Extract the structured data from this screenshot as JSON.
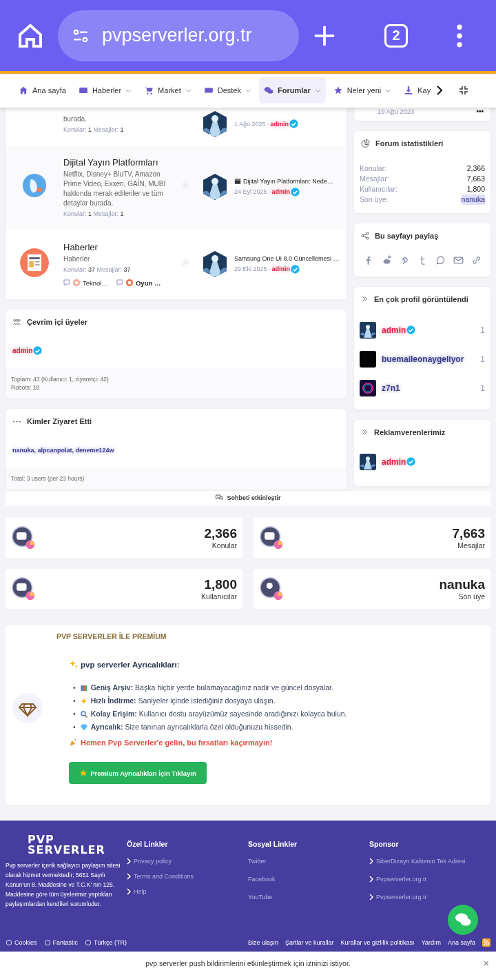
{
  "browser": {
    "url": "pvpserverler.org.tr",
    "tab_count": "2"
  },
  "nav": [
    {
      "label": "Ana sayfa",
      "selected": false,
      "caret": false
    },
    {
      "label": "Haberler",
      "selected": false,
      "caret": true
    },
    {
      "label": "Market",
      "selected": false,
      "caret": true
    },
    {
      "label": "Destek",
      "selected": false,
      "caret": true
    },
    {
      "label": "Forumlar",
      "selected": true,
      "caret": true
    },
    {
      "label": "Neler yeni",
      "selected": false,
      "caret": true
    },
    {
      "label": "Kay",
      "selected": false,
      "caret": false
    }
  ],
  "forums": [
    {
      "partial": true,
      "description": "burada.",
      "topics_label": "Konular:",
      "topics": "1",
      "messages_label": "Mesajlar:",
      "messages": "1",
      "last_date": "1 Ağu 2025",
      "separator": "·",
      "last_user": "admin"
    },
    {
      "partial": false,
      "title": "Dijital Yayın Platformları",
      "description": "Netflix, Disney+ BluTV, Amazon Prime Video, Exxen, GAİN, MUBI hakkında merak edilenler ve tüm detaylar burada.",
      "topics_label": "Konular:",
      "topics": "1",
      "messages_label": "Mesajlar:",
      "messages": "1",
      "last_title": "Dijital Yayın Platformları: Nede…",
      "last_date": "24 Eyl 2025",
      "separator": "·",
      "last_user": "admin"
    },
    {
      "partial": false,
      "title": "Haberler",
      "description": "Haberler",
      "topics_label": "Konular:",
      "topics": "37",
      "messages_label": "Mesajlar:",
      "messages": "37",
      "subforums": [
        "Teknol…",
        "Oyun …"
      ],
      "last_title": "Samsung One UI 8.0 Güncellemesi …",
      "last_date": "29 Eki 2025",
      "separator": "·",
      "last_user": "admin"
    }
  ],
  "online": {
    "title": "Çevrim içi üyeler",
    "users": [
      {
        "name": "admin",
        "color": "#e0244a",
        "verified": true
      }
    ],
    "summary": [
      "Toplam: 43 (Kullanıcı: 1, ziyaretçi: 42)",
      "Robots: 18"
    ]
  },
  "visitors": {
    "title": "Kimler Ziyaret Etti",
    "names": "nanuka, alpcanpolat, deneme124w",
    "total": "Total: 3 users (per 23 hours)"
  },
  "sidebar": {
    "top_card": {
      "date": "19 Ağu 2023",
      "more": "•••"
    },
    "stats": {
      "title": "Forum istatistikleri",
      "rows": [
        {
          "label": "Konular:",
          "value": "2,366",
          "kind": "plain"
        },
        {
          "label": "Mesajlar:",
          "value": "7,663",
          "kind": "plain"
        },
        {
          "label": "Kullanıcılar:",
          "value": "1,800",
          "kind": "plain"
        },
        {
          "label": "Son üye:",
          "value": "nanuka",
          "kind": "user"
        }
      ]
    },
    "share": {
      "title": "Bu sayfayı paylaş"
    },
    "most_viewed": {
      "title": "En çok profil görüntülendi",
      "users": [
        {
          "name": "admin",
          "color": "#e0244a",
          "verified": true,
          "count": "1"
        },
        {
          "name": "buemaileonaygeliyor",
          "color": "#3b3b8c",
          "verified": false,
          "count": "1"
        },
        {
          "name": "z7n1",
          "color": "#3b3b8c",
          "verified": false,
          "count": "1"
        }
      ]
    },
    "advertisers": {
      "title": "Reklamverenlerimiz",
      "users": [
        {
          "name": "admin",
          "color": "#e0244a",
          "verified": true
        }
      ]
    }
  },
  "chat_bar": "Sohbeti etkinleştir",
  "stat_tiles": [
    {
      "value": "2,366",
      "label": "Konular"
    },
    {
      "value": "7,663",
      "label": "Mesajlar"
    },
    {
      "value": "1,800",
      "label": "Kullanıcılar"
    },
    {
      "value": "nanuka",
      "label": "Son üye"
    }
  ],
  "premium": {
    "heading": "PVP SERVERLER İLE PREMİUM",
    "subheading": "pvp serverler Ayrıcalıkları:",
    "items": [
      {
        "bullet": "•",
        "bold": "Geniş Arşiv:",
        "text": "Başka hiçbir yerde bulamayacağınız nadir ve güncel dosyalar."
      },
      {
        "bullet": "•",
        "bold": "Hızlı İndirme:",
        "text": "Saniyeler içinde istediğiniz dosyaya ulaşın."
      },
      {
        "bullet": "•",
        "bold": "Kolay Erişim:",
        "text": "Kullanıcı dostu arayüzümüz sayesinde aradığınızı kolayca bulun."
      },
      {
        "bullet": "•",
        "bold": "Ayrıcalık:",
        "text": "Size tanınan ayrıcalıklarla özel olduğunuzu hissedin."
      }
    ],
    "cta": "Hemen Pvp Serverler'e gelin, bu fırsatları kaçırmayın!",
    "button": "Premium Ayrıcalıkları İçin Tıklayın"
  },
  "footer": {
    "logo": [
      "PVP",
      "SERVERLER"
    ],
    "about": "Pvp serverler içerik sağlayıcı paylaşım sitesi olarak hizmet vermektedir; 5651 Sayılı Kanun'un 8. Maddesine ve T.C.K' nın 125. Maddesine göre tüm üyelerimiz yaptıkları paylaşımlardan kendileri sorumludur.",
    "columns": [
      {
        "title": "Özel Linkler",
        "chevrons": true,
        "links": [
          "Privacy policy",
          "Terms and Conditions",
          "Help"
        ]
      },
      {
        "title": "Sosyal Linkler",
        "chevrons": false,
        "links": [
          "Twitter",
          "Facebook",
          "YouTube"
        ]
      },
      {
        "title": "Sponsor",
        "chevrons": true,
        "links": [
          "SiberDizayn Kalitenin Tek Adresi",
          "Pvpserverler.org.tr",
          "Pvpserverler.org.tr"
        ]
      }
    ],
    "bottom_left": [
      "Cookies",
      "Fantastic",
      "Türkçe (TR)"
    ],
    "bottom_right": [
      "Bize ulaşın",
      "Şartlar ve kurallar",
      "Kurallar ve gizlilik politikası",
      "Yardım",
      "Ana sayfa"
    ]
  },
  "push": {
    "text": "pvp serverler push bildirimlerini etkinleştirmek için izninizi istiyor.",
    "close": "×"
  }
}
